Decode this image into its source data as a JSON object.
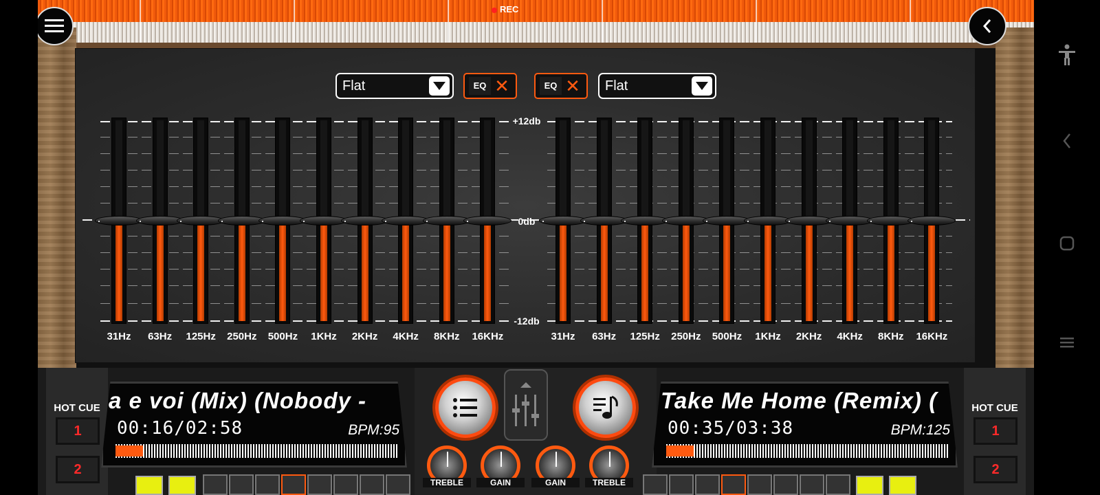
{
  "top": {
    "rec_label": "REC"
  },
  "eq": {
    "left": {
      "preset": "Flat",
      "toggle": "EQ"
    },
    "right": {
      "preset": "Flat",
      "toggle": "EQ"
    },
    "db_labels": {
      "max": "+12db",
      "mid": "0db",
      "min": "-12db"
    },
    "bands": [
      "31Hz",
      "63Hz",
      "125Hz",
      "250Hz",
      "500Hz",
      "1KHz",
      "2KHz",
      "4KHz",
      "8KHz",
      "16KHz"
    ]
  },
  "deck_left": {
    "hot_cue_title": "HOT CUE",
    "cues": [
      "1",
      "2"
    ],
    "track_title": "a e  voi (Mix) (Nobody -",
    "time": "00:16/02:58",
    "bpm": "BPM:95"
  },
  "deck_right": {
    "hot_cue_title": "HOT CUE",
    "cues": [
      "1",
      "2"
    ],
    "track_title": "Take Me Home (Remix) (",
    "time": "00:35/03:38",
    "bpm": "BPM:125"
  },
  "mixer": {
    "knob_labels": [
      "TREBLE",
      "GAIN",
      "GAIN",
      "TREBLE"
    ]
  },
  "icons": {
    "menu": "menu-icon",
    "back": "back-icon",
    "playlist": "playlist-icon",
    "music_note": "music-note-icon",
    "mixer": "mixer-sliders-icon"
  },
  "colors": {
    "accent": "#ff5a10",
    "cue_text": "#ff2a2a"
  }
}
